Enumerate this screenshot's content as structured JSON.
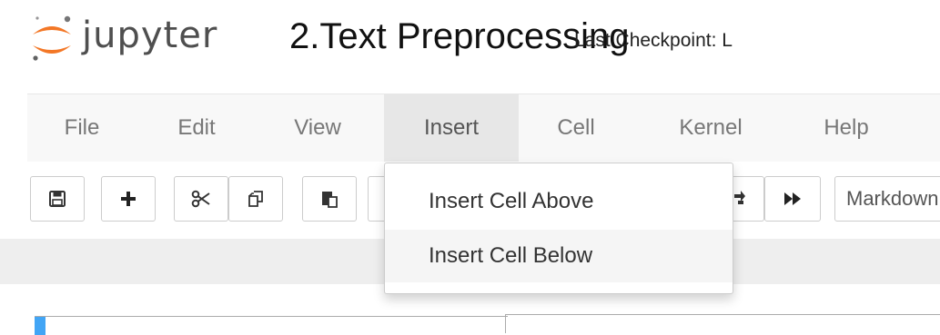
{
  "header": {
    "logo_text": "jupyter",
    "notebook_name": "2.Text Preprocessing",
    "checkpoint": "Last Checkpoint: L"
  },
  "menubar": {
    "items": [
      {
        "label": "File"
      },
      {
        "label": "Edit"
      },
      {
        "label": "View"
      },
      {
        "label": "Insert",
        "active": true
      },
      {
        "label": "Cell"
      },
      {
        "label": "Kernel"
      },
      {
        "label": "Help"
      }
    ]
  },
  "insert_menu": {
    "items": [
      {
        "label": "Insert Cell Above"
      },
      {
        "label": "Insert Cell Below",
        "hovered": true
      }
    ]
  },
  "toolbar": {
    "buttons": [
      {
        "icon": "save-icon"
      },
      {
        "icon": "plus-icon"
      },
      {
        "icon": "scissors-icon"
      },
      {
        "icon": "copy-icon"
      },
      {
        "icon": "paste-icon"
      },
      {
        "icon": "restart-icon"
      },
      {
        "icon": "fast-forward-icon"
      }
    ],
    "cell_type": "Markdown"
  },
  "colors": {
    "logo_orange": "#f37726",
    "menu_active_bg": "#e7e7e7",
    "cell_marker": "#42a5f5"
  }
}
